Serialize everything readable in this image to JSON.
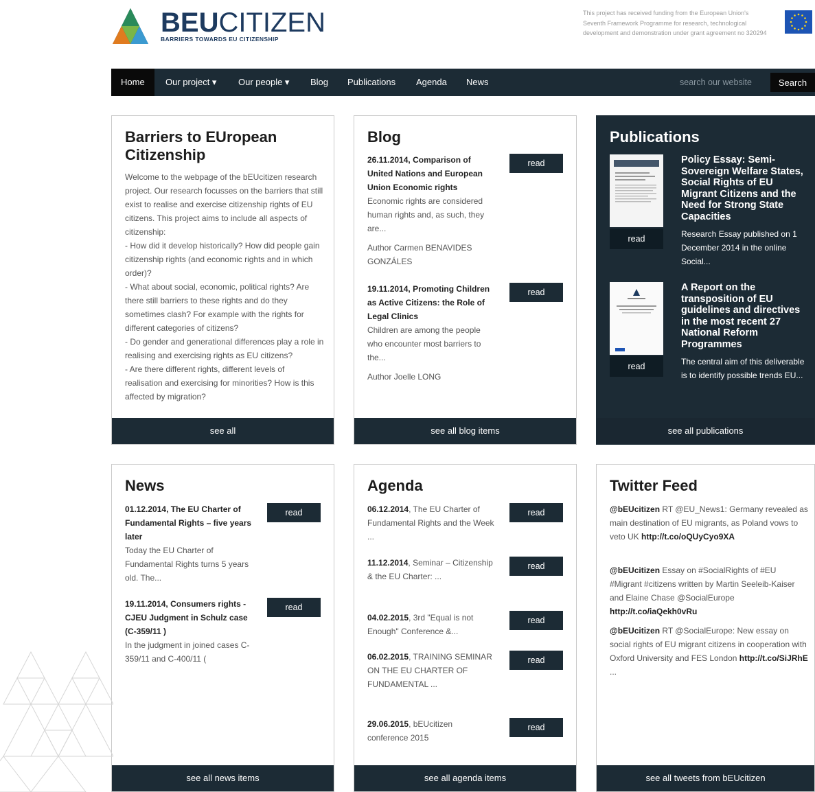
{
  "header": {
    "logo_name_bold": "BEU",
    "logo_name_rest": "CITIZEN",
    "logo_tagline": "BARRIERS TOWARDS EU CITIZENSHIP",
    "funding_text": "This project has received funding from the European Union's Seventh Framework Programme for research, technological development and demonstration under grant agreement no 320294"
  },
  "nav": {
    "items": [
      "Home",
      "Our project ▾",
      "Our people ▾",
      "Blog",
      "Publications",
      "Agenda",
      "News"
    ],
    "search_placeholder": "search our website",
    "search_button": "Search"
  },
  "intro": {
    "title": "Barriers to EUropean Citizenship",
    "body": [
      "Welcome to the webpage of the bEUcitizen research project. Our research focusses on the barriers that still exist to realise and exercise citizenship rights of EU citizens. This project aims to include all aspects of citizenship:",
      "- How did it develop historically? How did people gain citizenship rights (and economic rights and in which order)?",
      "- What about social, economic, political rights? Are there still barriers to these rights and do they sometimes clash? For example with the rights for different categories of citizens?",
      "- Do gender and generational differences play a role in realising and exercising rights as EU citizens?",
      "- Are there different rights, different levels of realisation and exercising for minorities? How is this affected by migration?"
    ],
    "footer": "see all"
  },
  "blog": {
    "title": "Blog",
    "items": [
      {
        "date": "26.11.2014",
        "title": ", Comparison of United Nations and European Union Economic rights",
        "excerpt": "Economic rights are considered human rights and, as such, they are...",
        "author": "Author Carmen BENAVIDES GONZÁLES",
        "read": "read"
      },
      {
        "date": "19.11.2014",
        "title": ", Promoting Children as Active Citizens: the Role of Legal Clinics",
        "excerpt": "Children are among the people who encounter most barriers to the...",
        "author": "Author Joelle LONG",
        "read": "read"
      }
    ],
    "footer": "see all blog items"
  },
  "publications": {
    "title": "Publications",
    "items": [
      {
        "title": "Policy Essay: Semi-Sovereign Welfare States, Social Rights of EU Migrant Citizens and the Need for Strong State Capacities",
        "desc": "Research Essay published on 1 December 2014 in the online Social...",
        "read": "read"
      },
      {
        "title": "A Report on the transposition of EU guidelines and directives in the most recent 27 National Reform Programmes",
        "desc": "The central aim of this deliverable is to identify possible trends EU...",
        "read": "read"
      }
    ],
    "footer": "see all publications"
  },
  "news": {
    "title": "News",
    "items": [
      {
        "date": "01.12.2014",
        "title": ", The EU Charter of Fundamental Rights – five years later",
        "excerpt": "Today the EU Charter of Fundamental Rights turns 5 years old. The...",
        "read": "read"
      },
      {
        "date": "19.11.2014",
        "title": ", Consumers rights - CJEU Judgment in Schulz case (C-359/11 )",
        "excerpt": "In the judgment in joined cases C-359/11 and C-400/11 (",
        "read": "read"
      }
    ],
    "footer": "see all news items"
  },
  "agenda": {
    "title": "Agenda",
    "items": [
      {
        "date": "06.12.2014",
        "title": ", The EU Charter of Fundamental Rights and the Week ...",
        "read": "read"
      },
      {
        "date": "11.12.2014",
        "title": ", Seminar – Citizenship & the EU Charter: ...",
        "read": "read"
      },
      {
        "date": "04.02.2015",
        "title": ", 3rd \"Equal is not Enough\" Conference &...",
        "read": "read"
      },
      {
        "date": "06.02.2015",
        "title": ", TRAINING SEMINAR ON THE EU CHARTER OF FUNDAMENTAL ...",
        "read": "read"
      },
      {
        "date": "29.06.2015",
        "title": ", bEUcitizen conference 2015",
        "read": "read"
      }
    ],
    "footer": "see all agenda items"
  },
  "twitter": {
    "title": "Twitter Feed",
    "tweets": [
      {
        "user": "@bEUcitizen",
        "text": " RT @EU_News1: Germany revealed as main destination of EU migrants, as Poland vows to veto UK ",
        "link": "http://t.co/oQUyCyo9XA"
      },
      {
        "user": "@bEUcitizen",
        "text": " Essay on #SocialRights of #EU #Migrant #citizens written by Martin Seeleib-Kaiser and Elaine Chase @SocialEurope ",
        "link": "http://t.co/iaQekh0vRu"
      },
      {
        "user": "@bEUcitizen",
        "text": " RT @SocialEurope: New essay on social rights of EU migrant citizens in cooperation with Oxford University and FES London ",
        "link": "http://t.co/SiJRhE",
        "suffix": " ..."
      }
    ],
    "footer": "see all tweets from bEUcitizen"
  }
}
